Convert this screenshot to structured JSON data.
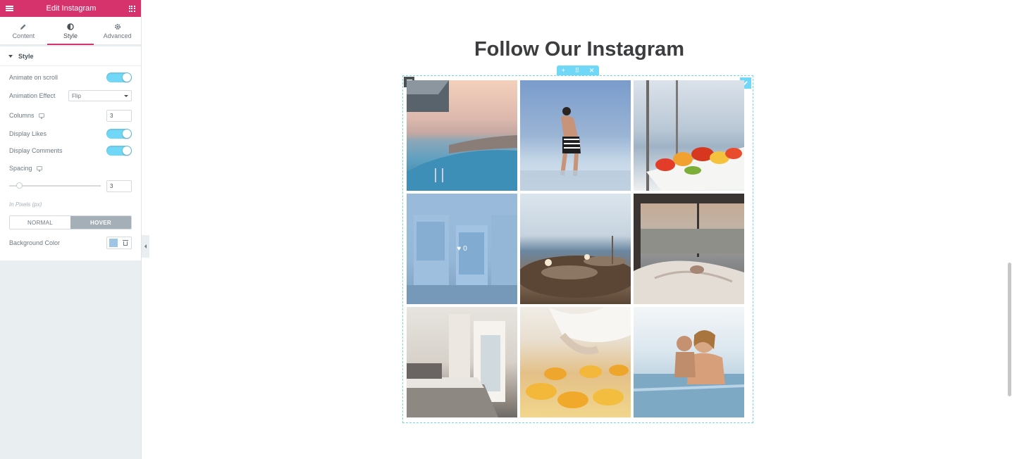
{
  "panel": {
    "title": "Edit Instagram",
    "tabs": [
      {
        "label": "Content"
      },
      {
        "label": "Style"
      },
      {
        "label": "Advanced"
      }
    ],
    "active_tab": "Style",
    "section_title": "Style",
    "animate_on_scroll": {
      "label": "Animate on scroll",
      "state": "on"
    },
    "animation_effect": {
      "label": "Animation Effect",
      "value": "Flip"
    },
    "columns": {
      "label": "Columns",
      "value": "3"
    },
    "display_likes": {
      "label": "Display Likes",
      "state": "on"
    },
    "display_comments": {
      "label": "Display Comments",
      "state": "on"
    },
    "spacing": {
      "label": "Spacing",
      "value": "3",
      "fraction": 0.08
    },
    "unit_hint": "In Pixels (px)",
    "state_tabs": {
      "normal": "NORMAL",
      "hover": "HOVER",
      "active": "HOVER"
    },
    "background_color": {
      "label": "Background Color",
      "value": "#9ec5e6"
    },
    "accent_color": "#d6336c",
    "switch_color": "#71d7f7"
  },
  "preview": {
    "title": "Follow Our Instagram",
    "hover_overlay": {
      "likes": "0"
    },
    "photos": [
      {
        "subject": "infinity pool at sunset"
      },
      {
        "subject": "boy walking in water"
      },
      {
        "subject": "fruit platter"
      },
      {
        "subject": "balcony doors"
      },
      {
        "subject": "terrace tables with sea view"
      },
      {
        "subject": "bedroom with sea view"
      },
      {
        "subject": "hotel bedroom"
      },
      {
        "subject": "pastry desserts"
      },
      {
        "subject": "woman in pool"
      }
    ]
  }
}
